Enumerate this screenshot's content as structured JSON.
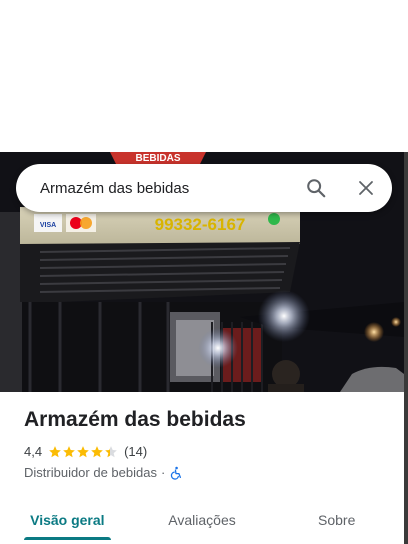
{
  "search": {
    "query": "Armazém das bebidas"
  },
  "photo": {
    "sign_logo": "BEBIDAS",
    "sign_phone": "99332-6167",
    "card_visa": "VISA"
  },
  "place": {
    "name": "Armazém das bebidas",
    "rating": "4,4",
    "stars": 4.4,
    "review_count": "(14)",
    "category": "Distribuidor de bebidas",
    "separator": "·"
  },
  "tabs": [
    {
      "label": "Visão geral",
      "active": true
    },
    {
      "label": "Avaliações",
      "active": false
    },
    {
      "label": "Sobre",
      "active": false
    }
  ],
  "colors": {
    "accent": "#0b7a83",
    "star": "#fbbc04",
    "accessibility": "#1a73e8"
  },
  "icons": [
    "search-icon",
    "close-icon",
    "star-icon",
    "wheelchair-icon",
    "whatsapp-icon"
  ]
}
